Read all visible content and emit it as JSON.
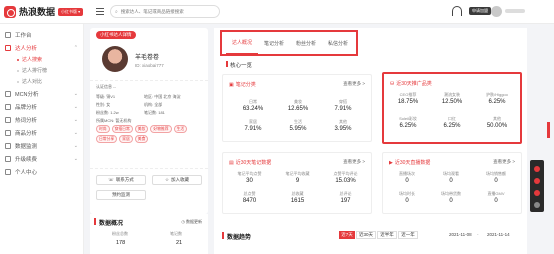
{
  "app": {
    "name": "热浪数据",
    "badge": "小红书版 ▾",
    "search_placeholder": "搜索达人、笔记或商品链接搜索",
    "top_button": "申请加盟"
  },
  "sidebar": {
    "items": [
      {
        "label": "工作台",
        "type": "item"
      },
      {
        "label": "达人分析",
        "type": "item",
        "active": true,
        "chev": "⌃"
      },
      {
        "label": "达人搜索",
        "type": "sub",
        "active": true
      },
      {
        "label": "达人排行榜",
        "type": "sub"
      },
      {
        "label": "达人对比",
        "type": "sub"
      },
      {
        "label": "MCN分析",
        "type": "item",
        "chev": "⌄"
      },
      {
        "label": "品牌分析",
        "type": "item",
        "chev": "⌄"
      },
      {
        "label": "热词分析",
        "type": "item",
        "chev": "⌄"
      },
      {
        "label": "商品分析",
        "type": "item",
        "chev": "⌄"
      },
      {
        "label": "数据监测",
        "type": "item",
        "chev": "⌄"
      },
      {
        "label": "升级续费",
        "type": "item",
        "chev": "⌄"
      },
      {
        "label": "个人中心",
        "type": "item"
      }
    ]
  },
  "profile": {
    "tag": "小红书达人详情",
    "name": "羊毛卷卷",
    "id": "ID: xiaobai777",
    "cert": "认证信息 --",
    "rows": [
      [
        "等级: 铜V1",
        "地区: 中国 北京 海淀"
      ],
      [
        "性别: 女",
        "机构: 全部"
      ],
      [
        "粉丝数: 1.2w",
        "笔记数: 181"
      ],
      [
        "所属MCN: 暂无机构",
        ""
      ]
    ],
    "tags": [
      "时尚",
      "穿搭日常",
      "美妆",
      "好物推荐",
      "生活",
      "日常分享",
      "家居",
      "美食"
    ],
    "btn_contact": "联系方式",
    "btn_favorite": "加入收藏",
    "btn_monitor": "预约监测"
  },
  "overview": {
    "title": "数据概况",
    "right": "◷ 数据更新",
    "labels": [
      "粉丝总数",
      "笔记数"
    ],
    "values": [
      "178",
      "21"
    ]
  },
  "tabs": [
    "达人概况",
    "笔记分析",
    "粉丝分析",
    "私信分析"
  ],
  "section_title": "核心一览",
  "cards": {
    "notes": {
      "title": "笔记分类",
      "more": "查看更多 >",
      "stats": [
        [
          "日常",
          "63.24%"
        ],
        [
          "美妆",
          "12.65%"
        ],
        [
          "穿搭",
          "7.91%"
        ],
        [
          "家居",
          "7.91%"
        ],
        [
          "生活",
          "5.95%"
        ],
        [
          "其他",
          "3.95%"
        ]
      ]
    },
    "products": {
      "title": "近30天推广品类",
      "more": "查看更多 >",
      "stats": [
        [
          "CEO推荐",
          "18.75%"
        ],
        [
          "潮流女装",
          "12.50%"
        ],
        [
          "护肤/Higgoo",
          "6.25%"
        ],
        [
          "Soleil彩妆",
          "6.25%"
        ],
        [
          "口红",
          "6.25%"
        ],
        [
          "其他",
          "50.00%"
        ]
      ]
    },
    "recent_notes": {
      "title": "近30天笔记数据",
      "more": "查看更多 >",
      "stats": [
        [
          "笔记平均点赞",
          "30"
        ],
        [
          "笔记平均收藏",
          "9"
        ],
        [
          "点赞平均评论",
          "15.03%"
        ],
        [
          "总点赞",
          "8470"
        ],
        [
          "总收藏",
          "1615"
        ],
        [
          "总评论",
          "197"
        ]
      ]
    },
    "live": {
      "title": "近30天直播数据",
      "more": "查看更多 >",
      "stats": [
        [
          "直播场次",
          "0"
        ],
        [
          "场均观看",
          "0"
        ],
        [
          "场均销售额",
          "0"
        ],
        [
          "场均时长",
          "0"
        ],
        [
          "场均带货数",
          "0"
        ],
        [
          "直播GMV",
          "0"
        ]
      ]
    }
  },
  "trend": {
    "title": "数据趋势",
    "ranges": [
      "近7天",
      "近30天",
      "近半年",
      "近一年"
    ],
    "from": "2021-11-08",
    "to": "2021-11-14"
  },
  "colors": {
    "accent": "#e5393c"
  }
}
